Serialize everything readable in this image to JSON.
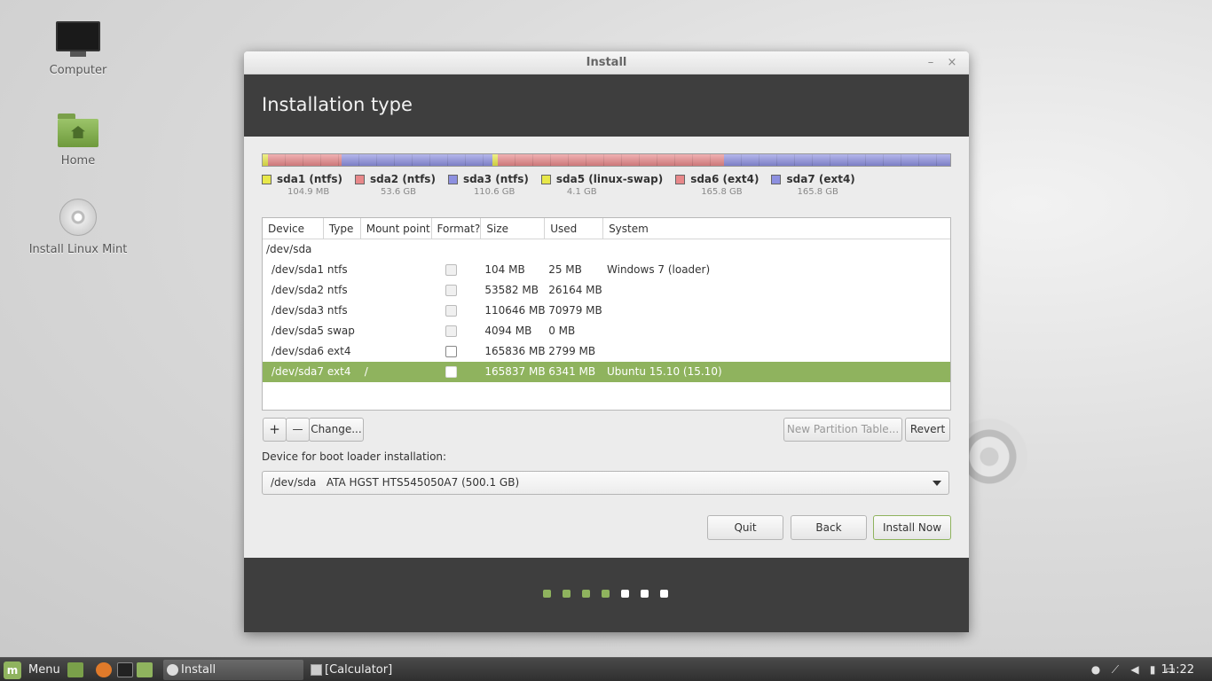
{
  "desktop": {
    "icons": [
      {
        "label": "Computer",
        "icon": "computer-icon"
      },
      {
        "label": "Home",
        "icon": "home-folder-icon"
      },
      {
        "label": "Install Linux Mint",
        "icon": "install-disc-icon"
      }
    ]
  },
  "window": {
    "title": "Install",
    "minimize": "–",
    "close": "×",
    "heading": "Installation type"
  },
  "partition_bar": [
    {
      "name": "sda1",
      "color": "#e8e84a",
      "size_gb": 0.1
    },
    {
      "name": "sda2",
      "color": "#e8888a",
      "size_gb": 53.6
    },
    {
      "name": "sda3",
      "color": "#8d90e0",
      "size_gb": 110.6
    },
    {
      "name": "sda5",
      "color": "#e8e84a",
      "size_gb": 4.1
    },
    {
      "name": "sda6",
      "color": "#e8888a",
      "size_gb": 165.8
    },
    {
      "name": "sda7",
      "color": "#8d90e0",
      "size_gb": 165.8
    }
  ],
  "legend": [
    {
      "name": "sda1 (ntfs)",
      "size": "104.9 MB",
      "color": "#e8e84a"
    },
    {
      "name": "sda2 (ntfs)",
      "size": "53.6 GB",
      "color": "#e8888a"
    },
    {
      "name": "sda3 (ntfs)",
      "size": "110.6 GB",
      "color": "#8d90e0"
    },
    {
      "name": "sda5 (linux-swap)",
      "size": "4.1 GB",
      "color": "#e8e84a"
    },
    {
      "name": "sda6 (ext4)",
      "size": "165.8 GB",
      "color": "#e8888a"
    },
    {
      "name": "sda7 (ext4)",
      "size": "165.8 GB",
      "color": "#8d90e0"
    }
  ],
  "table": {
    "columns": [
      "Device",
      "Type",
      "Mount point",
      "Format?",
      "Size",
      "Used",
      "System"
    ],
    "disk_row": "/dev/sda",
    "rows": [
      {
        "device": "/dev/sda1",
        "type": "ntfs",
        "mount": "",
        "size": "104 MB",
        "used": "25 MB",
        "system": "Windows 7 (loader)",
        "format_enabled": false,
        "selected": false
      },
      {
        "device": "/dev/sda2",
        "type": "ntfs",
        "mount": "",
        "size": "53582 MB",
        "used": "26164 MB",
        "system": "",
        "format_enabled": false,
        "selected": false
      },
      {
        "device": "/dev/sda3",
        "type": "ntfs",
        "mount": "",
        "size": "110646 MB",
        "used": "70979 MB",
        "system": "",
        "format_enabled": false,
        "selected": false
      },
      {
        "device": "/dev/sda5",
        "type": "swap",
        "mount": "",
        "size": "4094 MB",
        "used": "0 MB",
        "system": "",
        "format_enabled": false,
        "selected": false
      },
      {
        "device": "/dev/sda6",
        "type": "ext4",
        "mount": "",
        "size": "165836 MB",
        "used": "2799 MB",
        "system": "",
        "format_enabled": true,
        "selected": false
      },
      {
        "device": "/dev/sda7",
        "type": "ext4",
        "mount": "/",
        "size": "165837 MB",
        "used": "6341 MB",
        "system": "Ubuntu 15.10 (15.10)",
        "format_enabled": true,
        "selected": true
      }
    ]
  },
  "toolbar": {
    "add": "+",
    "remove": "—",
    "change": "Change...",
    "new_table": "New Partition Table...",
    "revert": "Revert"
  },
  "bootloader": {
    "label": "Device for boot loader installation:",
    "value": "/dev/sda   ATA HGST HTS545050A7 (500.1 GB)"
  },
  "actions": {
    "quit": "Quit",
    "back": "Back",
    "install": "Install Now"
  },
  "progress": {
    "total": 7,
    "completed": 4
  },
  "taskbar": {
    "menu": "Menu",
    "tasks": [
      {
        "label": "Install",
        "active": true
      },
      {
        "label": "[Calculator]",
        "active": false
      }
    ],
    "clock": "11:22"
  }
}
